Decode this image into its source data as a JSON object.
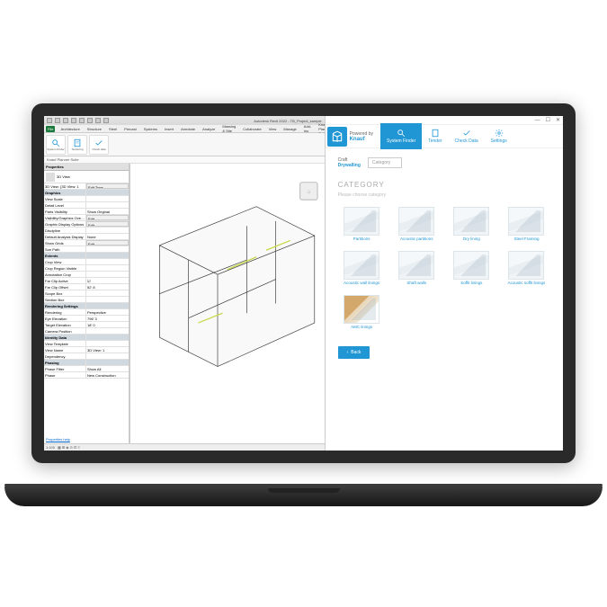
{
  "revit": {
    "title": "Autodesk Revit 2022 - TB_Project_sample",
    "menu": [
      "File",
      "Architecture",
      "Structure",
      "Steel",
      "Precast",
      "Systems",
      "Insert",
      "Annotate",
      "Analyze",
      "Massing & Site",
      "Collaborate",
      "View",
      "Manage",
      "Add-Ins",
      "Knauf Planner Suite"
    ],
    "ribbon": [
      "System Finder",
      "Tendering",
      "Check data"
    ],
    "subbar": "Knauf Planner Suite",
    "props": {
      "header": "Properties",
      "type": "3D View",
      "edit_type": "Edit Type",
      "instance": "3D View: {3D View: 1",
      "groups": [
        {
          "h": "Graphics",
          "rows": [
            [
              "View Scale",
              ""
            ],
            [
              "Detail Level",
              ""
            ],
            [
              "Parts Visibility",
              "Show Original"
            ],
            [
              "Visibility/Graphics Ove…",
              "Edit..."
            ],
            [
              "Graphic Display Options",
              "Edit..."
            ],
            [
              "Discipline",
              ""
            ],
            [
              "Default Analysis Display",
              "None"
            ],
            [
              "Show Grids",
              "Edit..."
            ],
            [
              "Sun Path",
              ""
            ]
          ]
        },
        {
          "h": "Extents",
          "rows": [
            [
              "Crop View",
              ""
            ],
            [
              "Crop Region Visible",
              ""
            ],
            [
              "Annotation Crop",
              ""
            ],
            [
              "Far Clip Active",
              "☑"
            ],
            [
              "Far Clip Offset",
              "52' 8"
            ],
            [
              "Scope Box",
              ""
            ],
            [
              "Section Box",
              ""
            ]
          ]
        },
        {
          "h": "Rendering Settings",
          "rows": [
            [
              "Rendering",
              "Perspective"
            ],
            [
              "Eye Elevation",
              "796' 3"
            ],
            [
              "Target Elevation",
              "18' 0"
            ],
            [
              "Camera Position",
              ""
            ]
          ]
        },
        {
          "h": "Identity Data",
          "rows": [
            [
              "View Template",
              "<None>"
            ],
            [
              "View Name",
              "3D View: 1"
            ],
            [
              "Dependency",
              ""
            ]
          ]
        },
        {
          "h": "Phasing",
          "rows": [
            [
              "Phase Filter",
              "Show All"
            ],
            [
              "Phase",
              "New Construction"
            ]
          ]
        }
      ],
      "help": "Properties help"
    },
    "status": "1:100"
  },
  "panel": {
    "powered": "Powered by",
    "brand": "Knauf",
    "tabs": [
      "System Finder",
      "Tender",
      "Check Data",
      "Settings"
    ],
    "filter_label": "Craft",
    "filter_value": "Drywalling",
    "filter_cat_label": "Category",
    "cat_title": "CATEGORY",
    "cat_sub": "Please choose category",
    "cards": [
      "Partitions",
      "Acoustic partitions",
      "Dry lining",
      "Steel Framing",
      "Acoustic wall linings",
      "Shaft walls",
      "Soffit linings",
      "Acoustic soffit linings",
      "AMC linings"
    ],
    "back": "Back"
  }
}
